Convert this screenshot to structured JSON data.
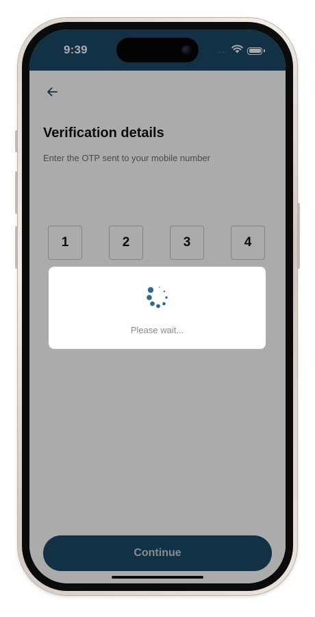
{
  "status_bar": {
    "time": "9:39",
    "signal": "....",
    "wifi_icon": "wifi-icon",
    "battery_icon": "battery-icon"
  },
  "header": {
    "back_icon": "arrow-left-icon"
  },
  "page": {
    "title": "Verification details",
    "subtitle": "Enter the OTP sent to your mobile number"
  },
  "otp": {
    "digits": [
      "1",
      "2",
      "3",
      "4"
    ]
  },
  "loading": {
    "message": "Please wait...",
    "spinner_icon": "spinner-icon"
  },
  "actions": {
    "continue_label": "Continue"
  },
  "colors": {
    "brand": "#1b4a66",
    "overlay": "rgba(0,0,0,0.33)",
    "spinner": "#2b6a92"
  }
}
